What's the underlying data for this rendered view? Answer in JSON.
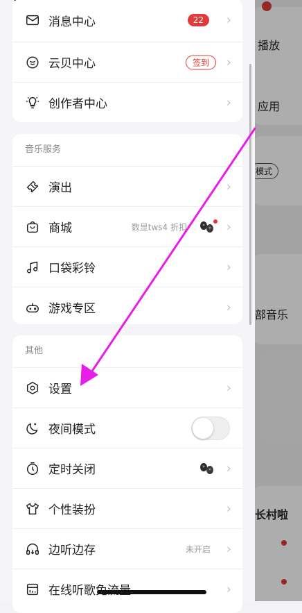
{
  "background": {
    "labels": [
      "播放",
      "应用",
      "模式",
      "部音乐",
      "长村啦"
    ]
  },
  "account_card": {
    "items": [
      {
        "label": "消息中心",
        "icon": "mail-icon",
        "badge": "22"
      },
      {
        "label": "云贝中心",
        "icon": "coin-icon",
        "action": "签到"
      },
      {
        "label": "创作者中心",
        "icon": "bulb-icon"
      }
    ]
  },
  "music_services": {
    "title": "音乐服务",
    "items": [
      {
        "label": "演出",
        "icon": "ticket-icon"
      },
      {
        "label": "商城",
        "icon": "bag-icon",
        "note": "数显tws4 折扣"
      },
      {
        "label": "口袋彩铃",
        "icon": "music-note-icon"
      },
      {
        "label": "游戏专区",
        "icon": "gamepad-icon"
      }
    ]
  },
  "other": {
    "title": "其他",
    "items": [
      {
        "label": "设置",
        "icon": "hexagon-gear-icon"
      },
      {
        "label": "夜间模式",
        "icon": "moon-icon",
        "toggle": false
      },
      {
        "label": "定时关闭",
        "icon": "timer-icon"
      },
      {
        "label": "个性装扮",
        "icon": "tshirt-icon"
      },
      {
        "label": "边听边存",
        "icon": "headphones-icon",
        "note": "未开启"
      },
      {
        "label": "在线听歌免流量",
        "icon": "sim-card-icon"
      }
    ]
  },
  "colors": {
    "accent_red": "#e03a3a",
    "annotation_arrow": "#e81ee8"
  }
}
